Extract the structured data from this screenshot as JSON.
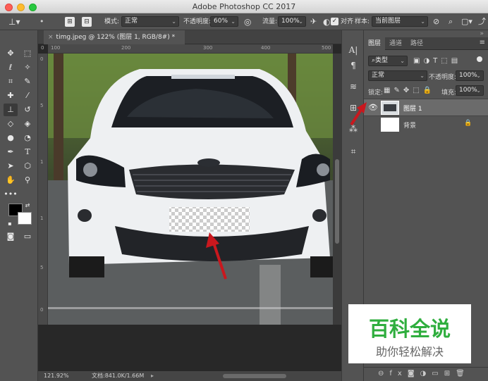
{
  "window": {
    "title": "Adobe Photoshop CC 2017"
  },
  "options": {
    "mode_label": "模式:",
    "mode_value": "正常",
    "opacity_label": "不透明度:",
    "opacity_value": "60%",
    "flow_label": "流量:",
    "flow_value": "100%",
    "aligned_label": "对齐",
    "sample_label": "样本:",
    "sample_value": "当前图层"
  },
  "document": {
    "tab_title": "timg.jpeg @ 122% (图层 1, RGB/8#) *",
    "ruler_top": [
      "0",
      "100",
      "200",
      "300",
      "400",
      "500"
    ],
    "ruler_left": [
      "0",
      "5",
      "1",
      "1",
      "5",
      "0"
    ],
    "zoom": "121.92%",
    "doc_info": "文档:841.0K/1.66M"
  },
  "layers_panel": {
    "tabs": [
      "图层",
      "通道",
      "路径"
    ],
    "filter_label": "类型",
    "blend_mode": "正常",
    "opacity_label": "不透明度:",
    "opacity_value": "100%",
    "lock_label": "锁定:",
    "fill_label": "填充:",
    "fill_value": "100%",
    "layers": [
      {
        "name": "图层 1",
        "visible": true,
        "selected": true
      },
      {
        "name": "背景",
        "visible": false,
        "locked": true
      }
    ]
  },
  "watermark": {
    "line1": "百科全说",
    "line2": "助你轻松解决"
  },
  "colors": {
    "accent_red": "#c9181e",
    "watermark_green": "#2fae3e",
    "panel_bg": "#535353"
  }
}
